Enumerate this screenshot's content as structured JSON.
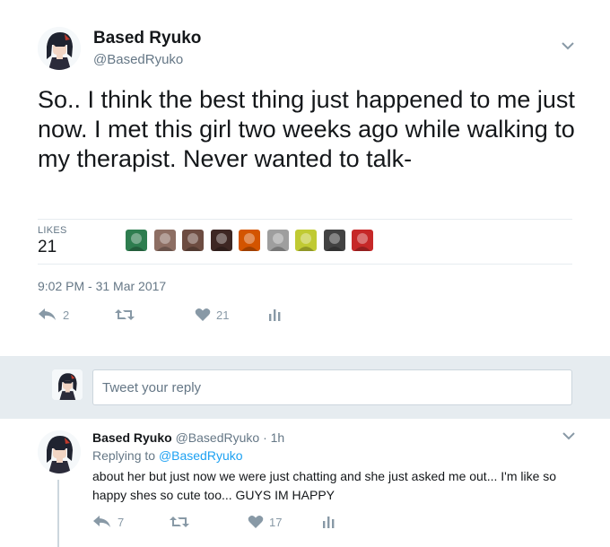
{
  "tweet": {
    "author_name": "Based Ryuko",
    "author_handle": "@BasedRyuko",
    "text": "So.. I think the best thing just happened to me just now. I met this girl two weeks ago while walking to my therapist. Never wanted to talk-",
    "likes_label": "LIKES",
    "likes_count": "21",
    "timestamp": "9:02 PM - 31 Mar 2017",
    "actions": {
      "reply_count": "2",
      "retweet_count": "",
      "like_count": "21"
    },
    "liker_avatar_colors": [
      "#2e7d4f",
      "#8d6e63",
      "#6d4c41",
      "#3e2723",
      "#d35400",
      "#9e9e9e",
      "#c0ca33",
      "#424242",
      "#c62828"
    ]
  },
  "reply_box": {
    "placeholder": "Tweet your reply"
  },
  "reply_tweet": {
    "author_name": "Based Ryuko",
    "author_handle": "@BasedRyuko",
    "separator": "·",
    "time": "1h",
    "replying_prefix": "Replying to",
    "replying_handle": "@BasedRyuko",
    "text": "about her but just now we were just chatting and she just asked me out... I'm like so happy shes so cute too... GUYS IM HAPPY",
    "actions": {
      "reply_count": "7",
      "retweet_count": "",
      "like_count": "17"
    }
  },
  "colors": {
    "text": "#14171a",
    "secondary": "#657786",
    "icon": "#8899a6",
    "link": "#1da1f2",
    "band": "#e6ecf0"
  },
  "icons": [
    "chevron-down-icon",
    "reply-icon",
    "retweet-icon",
    "heart-icon",
    "analytics-icon"
  ]
}
